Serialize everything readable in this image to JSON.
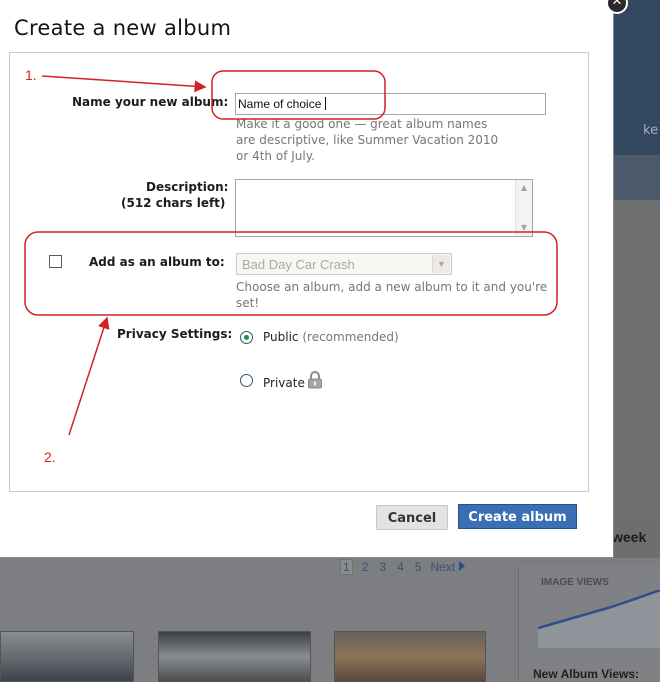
{
  "dialog": {
    "title": "Create a new album",
    "name_label": "Name your new album:",
    "name_value": "Name of choice",
    "name_helper_1": "Make it a good one — great album names",
    "name_helper_2": "are descriptive, like Summer Vacation 2010",
    "name_helper_3": "or 4th of July.",
    "description_label": "Description:",
    "description_count": "(512 chars left)",
    "add_album_label": "Add as an album to:",
    "album_select_value": "Bad Day Car Crash",
    "album_helper_1": "Choose an album, add a new album to it and you're",
    "album_helper_2": "set!",
    "privacy_label": "Privacy Settings:",
    "privacy_public": "Public",
    "privacy_public_note": "(recommended)",
    "privacy_private": "Private",
    "cancel_label": "Cancel",
    "create_label": "Create album"
  },
  "annotations": {
    "marker_1": "1.",
    "marker_2": "2.",
    "color": "#d22222"
  },
  "background": {
    "header_text": "ke",
    "week_label": "week",
    "pager": [
      "1",
      "2",
      "3",
      "4",
      "5"
    ],
    "pager_next": "Next",
    "image_views_label": "IMAGE VIEWS",
    "new_album_views_label": "New Album Views:"
  },
  "colors": {
    "primary_button": "#3b6fb4",
    "radio_selected": "#2c8a45"
  }
}
